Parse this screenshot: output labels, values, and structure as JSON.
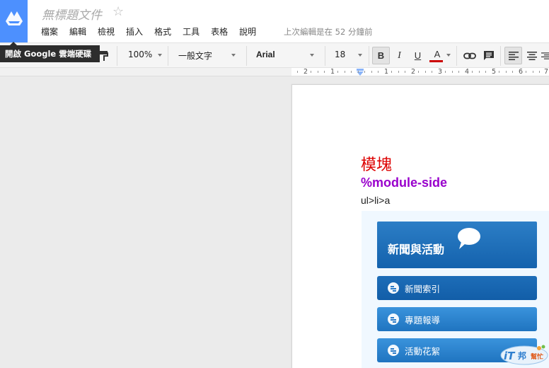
{
  "header": {
    "doc_title": "無標題文件",
    "menu": [
      "檔案",
      "編輯",
      "檢視",
      "插入",
      "格式",
      "工具",
      "表格",
      "說明"
    ],
    "last_edit": "上次編輯是在 52 分鐘前"
  },
  "tooltip": {
    "text": "開啟 Google 雲端硬碟"
  },
  "toolbar": {
    "zoom": "100%",
    "style": "一般文字",
    "font": "Arial",
    "size": "18",
    "bold_label": "B",
    "italic_label": "I",
    "underline_label": "U",
    "text_color_label": "A",
    "text_color": "#cc0000"
  },
  "ruler": {
    "numbers": [
      "2",
      "1",
      "1",
      "2",
      "3",
      "4",
      "5",
      "6",
      "7"
    ]
  },
  "document": {
    "heading": "模塊",
    "subheading": "%module-side",
    "selector": "ul>li>a",
    "module": {
      "title": "新聞與活動",
      "links": [
        "新聞索引",
        "專題報導",
        "活動花絮"
      ]
    }
  },
  "colors": {
    "drive_blue": "#4d90fe",
    "heading_red": "#dd0000",
    "subheading_purple": "#9900cc"
  }
}
